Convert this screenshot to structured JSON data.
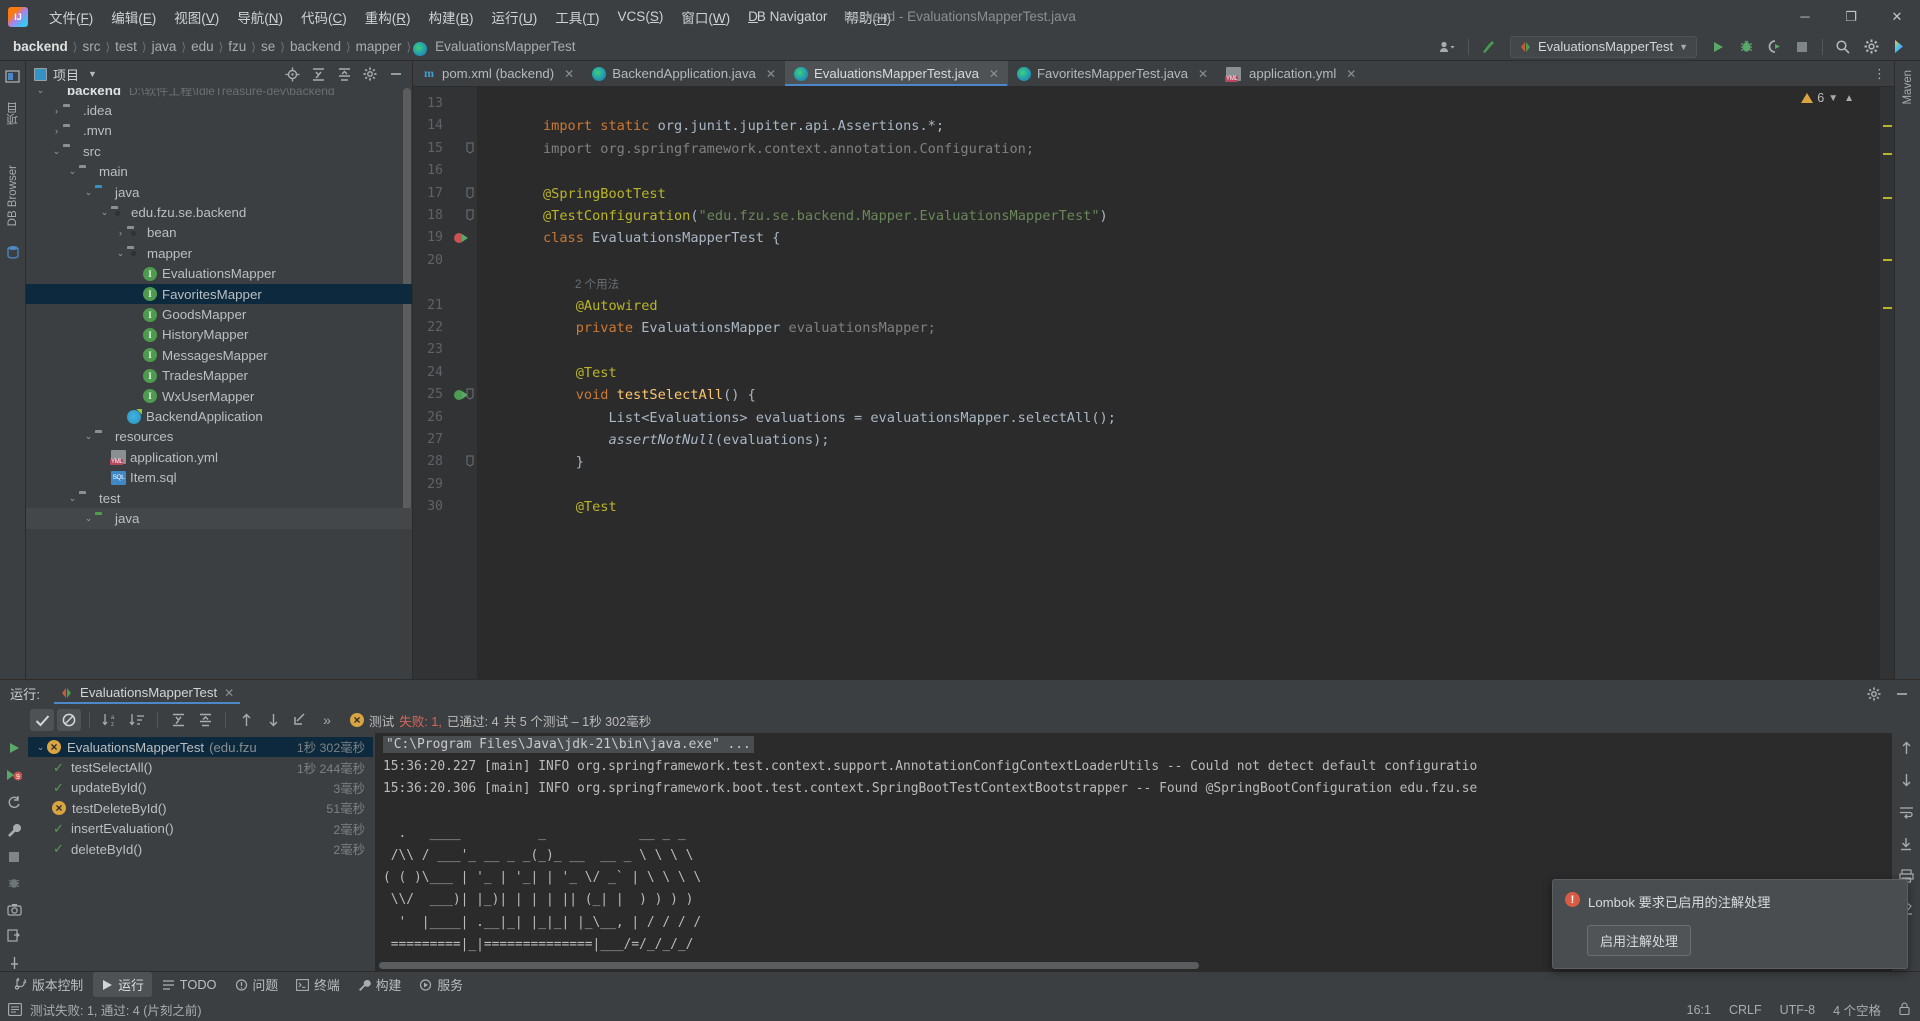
{
  "window": {
    "title": "backend - EvaluationsMapperTest.java",
    "controls": {
      "minimize": "─",
      "maximize": "❐",
      "close": "✕"
    }
  },
  "menubar": {
    "logo": "idea-logo-icon",
    "items": [
      {
        "label": "文件",
        "mnemonic": "F"
      },
      {
        "label": "编辑",
        "mnemonic": "E"
      },
      {
        "label": "视图",
        "mnemonic": "V"
      },
      {
        "label": "导航",
        "mnemonic": "N"
      },
      {
        "label": "代码",
        "mnemonic": "C"
      },
      {
        "label": "重构",
        "mnemonic": "R"
      },
      {
        "label": "构建",
        "mnemonic": "B"
      },
      {
        "label": "运行",
        "mnemonic": "U"
      },
      {
        "label": "工具",
        "mnemonic": "T"
      },
      {
        "label": "VCS",
        "mnemonic": "S"
      },
      {
        "label": "窗口",
        "mnemonic": "W"
      },
      {
        "label": "DB Navigator",
        "mnemonic": "D"
      },
      {
        "label": "帮助",
        "mnemonic": "H"
      }
    ]
  },
  "navbar": {
    "breadcrumbs": [
      "backend",
      "src",
      "test",
      "java",
      "edu",
      "fzu",
      "se",
      "backend",
      "mapper",
      "EvaluationsMapperTest"
    ],
    "separator": "〉",
    "run_configuration": "EvaluationsMapperTest",
    "actions": [
      "user-icon",
      "update-project-icon",
      "run-icon",
      "debug-icon",
      "run-coverage-icon",
      "stop-icon",
      "search-icon",
      "settings-icon",
      "ai-assistant-icon"
    ]
  },
  "left_strip": {
    "items": [
      "项目",
      "DB Browser"
    ]
  },
  "right_strip": {
    "items": [
      "Maven"
    ]
  },
  "project_panel": {
    "title": "项目",
    "header_actions": [
      "locate-icon",
      "expand-all-icon",
      "collapse-all-icon",
      "settings-icon",
      "hide-icon"
    ],
    "tree": [
      {
        "label": "backend",
        "path": "D:\\软件工程\\IdleTreasure-dev\\backend",
        "indent": 0,
        "arrow": "⌄",
        "icon": "module-icon",
        "bold": true,
        "clipped": true
      },
      {
        "label": ".idea",
        "indent": 1,
        "arrow": "›",
        "icon": "folder"
      },
      {
        "label": ".mvn",
        "indent": 1,
        "arrow": "›",
        "icon": "folder"
      },
      {
        "label": "src",
        "indent": 1,
        "arrow": "⌄",
        "icon": "folder"
      },
      {
        "label": "main",
        "indent": 2,
        "arrow": "⌄",
        "icon": "folder"
      },
      {
        "label": "java",
        "indent": 3,
        "arrow": "⌄",
        "icon": "folder-blue"
      },
      {
        "label": "edu.fzu.se.backend",
        "indent": 4,
        "arrow": "⌄",
        "icon": "package"
      },
      {
        "label": "bean",
        "indent": 5,
        "arrow": "›",
        "icon": "package"
      },
      {
        "label": "mapper",
        "indent": 5,
        "arrow": "⌄",
        "icon": "package"
      },
      {
        "label": "EvaluationsMapper",
        "indent": 6,
        "arrow": "",
        "icon": "interface"
      },
      {
        "label": "FavoritesMapper",
        "indent": 6,
        "arrow": "",
        "icon": "interface",
        "selected": true
      },
      {
        "label": "GoodsMapper",
        "indent": 6,
        "arrow": "",
        "icon": "interface"
      },
      {
        "label": "HistoryMapper",
        "indent": 6,
        "arrow": "",
        "icon": "interface"
      },
      {
        "label": "MessagesMapper",
        "indent": 6,
        "arrow": "",
        "icon": "interface"
      },
      {
        "label": "TradesMapper",
        "indent": 6,
        "arrow": "",
        "icon": "interface"
      },
      {
        "label": "WxUserMapper",
        "indent": 6,
        "arrow": "",
        "icon": "interface"
      },
      {
        "label": "BackendApplication",
        "indent": 5,
        "arrow": "",
        "icon": "spring-class"
      },
      {
        "label": "resources",
        "indent": 3,
        "arrow": "⌄",
        "icon": "folder-resources"
      },
      {
        "label": "application.yml",
        "indent": 4,
        "arrow": "",
        "icon": "yml"
      },
      {
        "label": "Item.sql",
        "indent": 4,
        "arrow": "",
        "icon": "sql"
      },
      {
        "label": "test",
        "indent": 2,
        "arrow": "⌄",
        "icon": "folder"
      },
      {
        "label": "java",
        "indent": 3,
        "arrow": "⌄",
        "icon": "folder-green",
        "partial": true
      }
    ]
  },
  "editor": {
    "tabs": [
      {
        "label": "pom.xml (backend)",
        "icon": "maven-icon",
        "active": false
      },
      {
        "label": "BackendApplication.java",
        "icon": "spring-class-icon",
        "active": false
      },
      {
        "label": "EvaluationsMapperTest.java",
        "icon": "test-class-icon",
        "active": true
      },
      {
        "label": "FavoritesMapperTest.java",
        "icon": "test-class-icon",
        "active": false
      },
      {
        "label": "application.yml",
        "icon": "yml-icon",
        "active": false
      }
    ],
    "inspection_count": "6",
    "lines": [
      {
        "n": 13,
        "segments": []
      },
      {
        "n": 14,
        "segments": [
          {
            "t": "import ",
            "c": "kw"
          },
          {
            "t": "static ",
            "c": "kw"
          },
          {
            "t": "org.junit.jupiter.api.Assertions.*;",
            "c": "plain"
          }
        ]
      },
      {
        "n": 15,
        "fold": "⊖",
        "segments": [
          {
            "t": "import org.springframework.context.annotation.Configuration;",
            "c": "grayimp"
          }
        ]
      },
      {
        "n": 16,
        "segments": []
      },
      {
        "n": 17,
        "fold": "⊖",
        "segments": [
          {
            "t": "@SpringBootTest",
            "c": "ann"
          }
        ]
      },
      {
        "n": 18,
        "fold": "⊖",
        "segments": [
          {
            "t": "@TestConfiguration",
            "c": "ann"
          },
          {
            "t": "(",
            "c": "plain"
          },
          {
            "t": "\"edu.fzu.se.backend.Mapper.EvaluationsMapperTest\"",
            "c": "str"
          },
          {
            "t": ")",
            "c": "plain"
          }
        ]
      },
      {
        "n": 19,
        "gutter": "spring-bean-run-icon",
        "segments": [
          {
            "t": "class ",
            "c": "kw"
          },
          {
            "t": "EvaluationsMapperTest ",
            "c": "plain"
          },
          {
            "t": "{",
            "c": "plain"
          }
        ]
      },
      {
        "n": 20,
        "segments": []
      },
      {
        "n": "",
        "hint": "2 个用法"
      },
      {
        "n": 21,
        "segments": [
          {
            "t": "    @Autowired",
            "c": "ann"
          }
        ]
      },
      {
        "n": 22,
        "segments": [
          {
            "t": "    private ",
            "c": "kw"
          },
          {
            "t": "EvaluationsMapper ",
            "c": "plain"
          },
          {
            "t": "evaluationsMapper;",
            "c": "dim"
          }
        ]
      },
      {
        "n": 23,
        "segments": []
      },
      {
        "n": 24,
        "segments": [
          {
            "t": "    @Test",
            "c": "ann"
          }
        ]
      },
      {
        "n": 25,
        "gutter": "run-test-icon",
        "fold": "⊖",
        "segments": [
          {
            "t": "    void ",
            "c": "kw"
          },
          {
            "t": "testSelectAll",
            "c": "mth"
          },
          {
            "t": "() {",
            "c": "plain"
          }
        ]
      },
      {
        "n": 26,
        "segments": [
          {
            "t": "        List<Evaluations> evaluations = evaluationsMapper.selectAll();",
            "c": "plain"
          }
        ]
      },
      {
        "n": 27,
        "segments": [
          {
            "t": "        assertNotNull",
            "c": "italic-plain"
          },
          {
            "t": "(evaluations);",
            "c": "plain"
          }
        ]
      },
      {
        "n": 28,
        "fold": "⊖",
        "segments": [
          {
            "t": "    }",
            "c": "plain"
          }
        ]
      },
      {
        "n": 29,
        "segments": []
      },
      {
        "n": 30,
        "segments": [
          {
            "t": "    @Test",
            "c": "ann"
          }
        ]
      }
    ]
  },
  "run_panel": {
    "label": "运行:",
    "tab_title": "EvaluationsMapperTest",
    "toolbar_buttons": [
      "rerun-icon",
      "show-passed-icon",
      "hide-ignored-icon",
      "sort-alphabetically-icon",
      "sort-by-duration-icon",
      "expand-all-icon",
      "collapse-all-icon",
      "prev-failed-icon",
      "next-failed-icon",
      "export-icon",
      "more-icon"
    ],
    "status": {
      "prefix": "测试 ",
      "failed_label": "失败: 1,",
      "passed_label": " 已通过: 4",
      "total_label": "共 5 个测试 – 1秒 302毫秒"
    },
    "tests": [
      {
        "name": "EvaluationsMapperTest",
        "suffix": "(edu.fzu",
        "time": "1秒 302毫秒",
        "status": "failed",
        "root": true,
        "selected": true,
        "arrow": "⌄"
      },
      {
        "name": "testSelectAll()",
        "time": "1秒 244毫秒",
        "status": "passed"
      },
      {
        "name": "updateById()",
        "time": "3毫秒",
        "status": "passed"
      },
      {
        "name": "testDeleteById()",
        "time": "51毫秒",
        "status": "failed"
      },
      {
        "name": "insertEvaluation()",
        "time": "2毫秒",
        "status": "passed"
      },
      {
        "name": "deleteById()",
        "time": "2毫秒",
        "status": "passed"
      }
    ],
    "console": [
      {
        "text": "\"C:\\Program Files\\Java\\jdk-21\\bin\\java.exe\" ...",
        "cmd": true
      },
      {
        "text": "15:36:20.227 [main] INFO org.springframework.test.context.support.AnnotationConfigContextLoaderUtils -- Could not detect default configuratio"
      },
      {
        "text": "15:36:20.306 [main] INFO org.springframework.boot.test.context.SpringBootTestContextBootstrapper -- Found @SpringBootConfiguration edu.fzu.se"
      },
      {
        "text": ""
      },
      {
        "text": "  .   ____          _            __ _ _"
      },
      {
        "text": " /\\\\ / ___'_ __ _ _(_)_ __  __ _ \\ \\ \\ \\"
      },
      {
        "text": "( ( )\\___ | '_ | '_| | '_ \\/ _` | \\ \\ \\ \\"
      },
      {
        "text": " \\\\/  ___)| |_)| | | | || (_| |  ) ) ) )"
      },
      {
        "text": "  '  |____| .__|_| |_|_| |_\\__, | / / / /"
      },
      {
        "text": " =========|_|==============|___/=/_/_/_/"
      }
    ],
    "console_actions": [
      "scroll-up-icon",
      "scroll-down-icon",
      "soft-wrap-icon",
      "scroll-to-end-icon",
      "print-icon",
      "clear-icon"
    ]
  },
  "notification": {
    "message": "Lombok 要求已启用的注解处理",
    "button": "启用注解处理",
    "icon": "warning-icon"
  },
  "tool_window_bar": {
    "items": [
      {
        "label": "版本控制",
        "icon": "vcs-icon",
        "active": false
      },
      {
        "label": "运行",
        "icon": "run-icon",
        "active": true
      },
      {
        "label": "TODO",
        "icon": "todo-icon",
        "active": false
      },
      {
        "label": "问题",
        "icon": "problems-icon",
        "active": false
      },
      {
        "label": "终端",
        "icon": "terminal-icon",
        "active": false
      },
      {
        "label": "构建",
        "icon": "build-icon",
        "active": false
      },
      {
        "label": "服务",
        "icon": "services-icon",
        "active": false
      }
    ]
  },
  "statusbar": {
    "icon": "event-log-icon",
    "message": "测试失败: 1, 通过: 4 (片刻之前)",
    "right": [
      "16:1",
      "CRLF",
      "UTF-8",
      "4 个空格"
    ]
  },
  "colors": {
    "accent": "#4a88c7",
    "selection": "#0d293e",
    "failed": "#d9a441",
    "passed": "#5a9e5a",
    "error": "#d95b43",
    "editor_bg": "#2b2b2b",
    "panel_bg": "#3c3f41"
  }
}
